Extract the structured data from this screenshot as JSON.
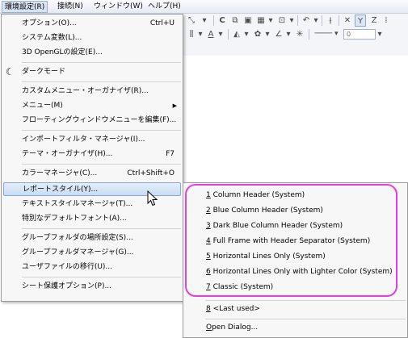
{
  "menubar": {
    "items": [
      {
        "label": "環境設定(R)",
        "active": true
      },
      {
        "label": "接続(N)"
      },
      {
        "label": "ウィンドウ(W)"
      },
      {
        "label": "ヘルプ(H)"
      }
    ]
  },
  "toolbar": {
    "line_width_value": "0"
  },
  "main_menu": {
    "items": [
      {
        "label": "オプション(O)...",
        "accel": "Ctrl+U"
      },
      {
        "label": "システム変数(L)..."
      },
      {
        "label": "3D OpenGLの設定(E)..."
      },
      {
        "label": "ダークモード",
        "icon": "moon-icon"
      },
      {
        "label": "カスタムメニュー・オーガナイザ(R)..."
      },
      {
        "label": "メニュー(M)",
        "submenu": true
      },
      {
        "label": "フローティングウィンドウメニューを編集(F)..."
      },
      {
        "label": "インポートフィルタ・マネージャ(I)..."
      },
      {
        "label": "テーマ・オーガナイザ(H)...",
        "accel": "F7"
      },
      {
        "label": "カラーマネージャ(C)...",
        "accel": "Ctrl+Shift+O"
      },
      {
        "label": "レポートスタイル(Y)...",
        "highlighted": true
      },
      {
        "label": "テキストスタイルマネージャ(T)..."
      },
      {
        "label": "特別なデフォルトフォント(A)..."
      },
      {
        "label": "グループフォルダの場所設定(S)..."
      },
      {
        "label": "グループフォルダマネージャ(G)..."
      },
      {
        "label": "ユーザファイルの移行(U)..."
      },
      {
        "label": "シート保護オプション(P)..."
      }
    ]
  },
  "sub_menu": {
    "items": [
      {
        "num": "1",
        "label": " Column Header (System)"
      },
      {
        "num": "2",
        "label": " Blue Column Header (System)"
      },
      {
        "num": "3",
        "label": " Dark Blue Column Header (System)"
      },
      {
        "num": "4",
        "label": " Full Frame with Header Separator (System)"
      },
      {
        "num": "5",
        "label": " Horizontal Lines Only (System)"
      },
      {
        "num": "6",
        "label": " Horizontal Lines Only with Lighter Color (System)"
      },
      {
        "num": "7",
        "label": " Classic (System)"
      },
      {
        "num": "8",
        "label": " <Last used>"
      },
      {
        "num": "O",
        "label": "pen Dialog..."
      }
    ]
  },
  "colors": {
    "highlight_frame": "#e23fe0",
    "menu_highlight": "#c9dcf4"
  }
}
